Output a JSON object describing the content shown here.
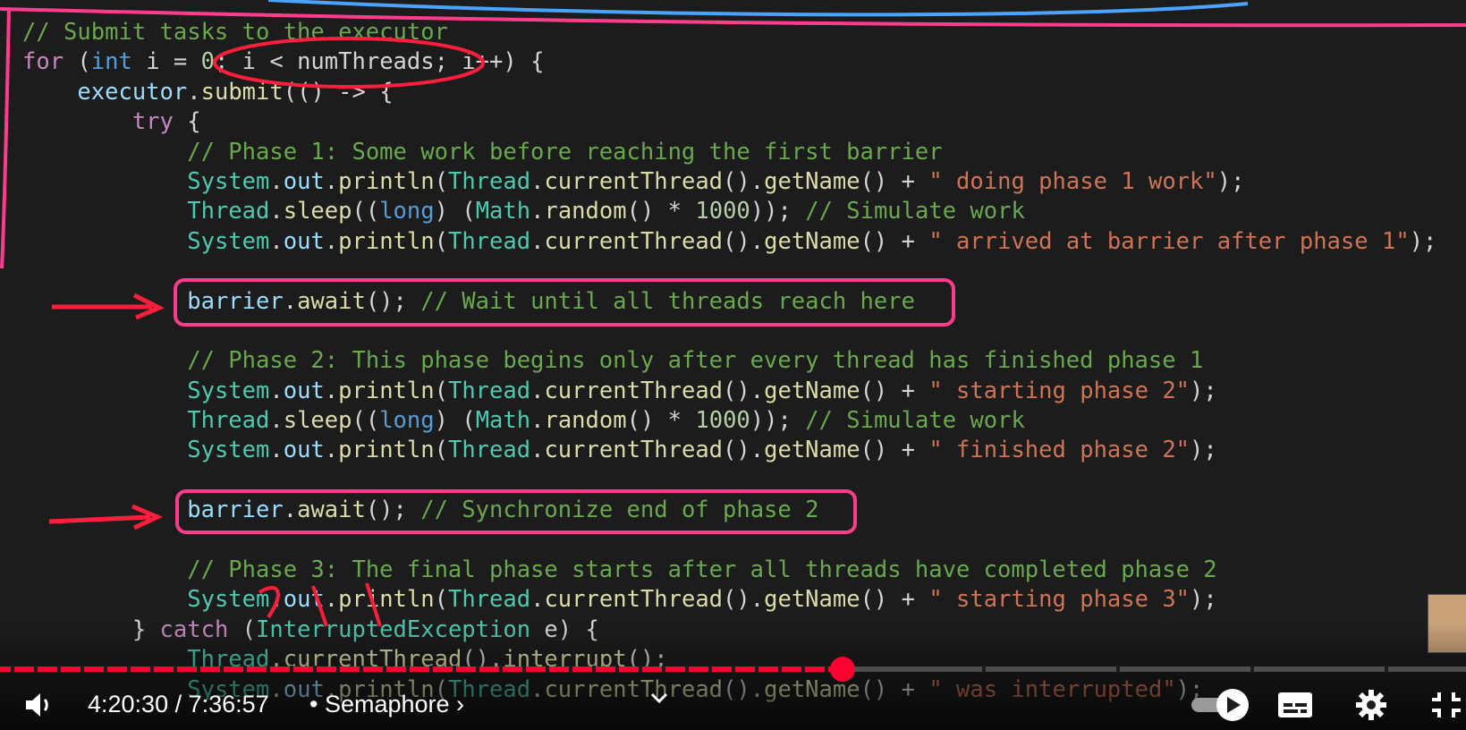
{
  "code_lines": [
    [
      [
        "c",
        "// Submit tasks to the executor"
      ]
    ],
    [
      [
        "kc",
        "for"
      ],
      [
        "p",
        " ("
      ],
      [
        "k",
        "int"
      ],
      [
        "p",
        " i = "
      ],
      [
        "n",
        "0"
      ],
      [
        "p",
        "; i < numThreads; i++) {"
      ]
    ],
    [
      [
        "p",
        "    "
      ],
      [
        "v",
        "executor"
      ],
      [
        "p",
        "."
      ],
      [
        "f",
        "submit"
      ],
      [
        "p",
        "(() -> {"
      ]
    ],
    [
      [
        "p",
        "        "
      ],
      [
        "kc",
        "try"
      ],
      [
        "p",
        " {"
      ]
    ],
    [
      [
        "p",
        "            "
      ],
      [
        "c",
        "// Phase 1: Some work before reaching the first barrier"
      ]
    ],
    [
      [
        "p",
        "            "
      ],
      [
        "t",
        "System"
      ],
      [
        "p",
        "."
      ],
      [
        "v",
        "out"
      ],
      [
        "p",
        "."
      ],
      [
        "f",
        "println"
      ],
      [
        "p",
        "("
      ],
      [
        "t",
        "Thread"
      ],
      [
        "p",
        "."
      ],
      [
        "f",
        "currentThread"
      ],
      [
        "p",
        "()."
      ],
      [
        "f",
        "getName"
      ],
      [
        "p",
        "() + "
      ],
      [
        "s",
        "\" doing phase 1 work\""
      ],
      [
        "p",
        ");"
      ]
    ],
    [
      [
        "p",
        "            "
      ],
      [
        "t",
        "Thread"
      ],
      [
        "p",
        "."
      ],
      [
        "f",
        "sleep"
      ],
      [
        "p",
        "(("
      ],
      [
        "k",
        "long"
      ],
      [
        "p",
        ") ("
      ],
      [
        "t",
        "Math"
      ],
      [
        "p",
        "."
      ],
      [
        "f",
        "random"
      ],
      [
        "p",
        "() * "
      ],
      [
        "n",
        "1000"
      ],
      [
        "p",
        "));"
      ],
      [
        "c",
        " // Simulate work"
      ]
    ],
    [
      [
        "p",
        "            "
      ],
      [
        "t",
        "System"
      ],
      [
        "p",
        "."
      ],
      [
        "v",
        "out"
      ],
      [
        "p",
        "."
      ],
      [
        "f",
        "println"
      ],
      [
        "p",
        "("
      ],
      [
        "t",
        "Thread"
      ],
      [
        "p",
        "."
      ],
      [
        "f",
        "currentThread"
      ],
      [
        "p",
        "()."
      ],
      [
        "f",
        "getName"
      ],
      [
        "p",
        "() + "
      ],
      [
        "s",
        "\" arrived at barrier after phase 1\""
      ],
      [
        "p",
        ");"
      ]
    ],
    [
      [
        "p",
        ""
      ]
    ],
    [
      [
        "p",
        "            "
      ],
      [
        "v",
        "barrier"
      ],
      [
        "p",
        "."
      ],
      [
        "f",
        "await"
      ],
      [
        "p",
        "(); "
      ],
      [
        "c",
        "// Wait until all threads reach here"
      ]
    ],
    [
      [
        "p",
        ""
      ]
    ],
    [
      [
        "p",
        "            "
      ],
      [
        "c",
        "// Phase 2: This phase begins only after every thread has finished phase 1"
      ]
    ],
    [
      [
        "p",
        "            "
      ],
      [
        "t",
        "System"
      ],
      [
        "p",
        "."
      ],
      [
        "v",
        "out"
      ],
      [
        "p",
        "."
      ],
      [
        "f",
        "println"
      ],
      [
        "p",
        "("
      ],
      [
        "t",
        "Thread"
      ],
      [
        "p",
        "."
      ],
      [
        "f",
        "currentThread"
      ],
      [
        "p",
        "()."
      ],
      [
        "f",
        "getName"
      ],
      [
        "p",
        "() + "
      ],
      [
        "s",
        "\" starting phase 2\""
      ],
      [
        "p",
        ");"
      ]
    ],
    [
      [
        "p",
        "            "
      ],
      [
        "t",
        "Thread"
      ],
      [
        "p",
        "."
      ],
      [
        "f",
        "sleep"
      ],
      [
        "p",
        "(("
      ],
      [
        "k",
        "long"
      ],
      [
        "p",
        ") ("
      ],
      [
        "t",
        "Math"
      ],
      [
        "p",
        "."
      ],
      [
        "f",
        "random"
      ],
      [
        "p",
        "() * "
      ],
      [
        "n",
        "1000"
      ],
      [
        "p",
        "));"
      ],
      [
        "c",
        " // Simulate work"
      ]
    ],
    [
      [
        "p",
        "            "
      ],
      [
        "t",
        "System"
      ],
      [
        "p",
        "."
      ],
      [
        "v",
        "out"
      ],
      [
        "p",
        "."
      ],
      [
        "f",
        "println"
      ],
      [
        "p",
        "("
      ],
      [
        "t",
        "Thread"
      ],
      [
        "p",
        "."
      ],
      [
        "f",
        "currentThread"
      ],
      [
        "p",
        "()."
      ],
      [
        "f",
        "getName"
      ],
      [
        "p",
        "() + "
      ],
      [
        "s",
        "\" finished phase 2\""
      ],
      [
        "p",
        ");"
      ]
    ],
    [
      [
        "p",
        ""
      ]
    ],
    [
      [
        "p",
        "            "
      ],
      [
        "v",
        "barrier"
      ],
      [
        "p",
        "."
      ],
      [
        "f",
        "await"
      ],
      [
        "p",
        "(); "
      ],
      [
        "c",
        "// Synchronize end of phase 2"
      ]
    ],
    [
      [
        "p",
        ""
      ]
    ],
    [
      [
        "p",
        "            "
      ],
      [
        "c",
        "// Phase 3: The final phase starts after all threads have completed phase 2"
      ]
    ],
    [
      [
        "p",
        "            "
      ],
      [
        "t",
        "System"
      ],
      [
        "p",
        "."
      ],
      [
        "v",
        "out"
      ],
      [
        "p",
        "."
      ],
      [
        "f",
        "println"
      ],
      [
        "p",
        "("
      ],
      [
        "t",
        "Thread"
      ],
      [
        "p",
        "."
      ],
      [
        "f",
        "currentThread"
      ],
      [
        "p",
        "()."
      ],
      [
        "f",
        "getName"
      ],
      [
        "p",
        "() + "
      ],
      [
        "s",
        "\" starting phase 3\""
      ],
      [
        "p",
        ");"
      ]
    ],
    [
      [
        "p",
        "        } "
      ],
      [
        "kc",
        "catch"
      ],
      [
        "p",
        " ("
      ],
      [
        "t",
        "InterruptedException"
      ],
      [
        "p",
        " e) {"
      ]
    ],
    [
      [
        "p",
        "            "
      ],
      [
        "t",
        "Thread"
      ],
      [
        "p",
        "."
      ],
      [
        "f",
        "currentThread"
      ],
      [
        "p",
        "()."
      ],
      [
        "f",
        "interrupt"
      ],
      [
        "p",
        "();"
      ]
    ],
    [
      [
        "p",
        "            "
      ],
      [
        "t",
        "System"
      ],
      [
        "p",
        "."
      ],
      [
        "v",
        "out"
      ],
      [
        "p",
        "."
      ],
      [
        "f",
        "println"
      ],
      [
        "p",
        "("
      ],
      [
        "t",
        "Thread"
      ],
      [
        "p",
        "."
      ],
      [
        "f",
        "currentThread"
      ],
      [
        "p",
        "()."
      ],
      [
        "f",
        "getName"
      ],
      [
        "p",
        "() + "
      ],
      [
        "s",
        "\" was interrupted\""
      ],
      [
        "p",
        ");"
      ]
    ]
  ],
  "player": {
    "time_current": "4:20:30",
    "time_separator": " / ",
    "time_total": "7:36:57",
    "chapter_title": "• Semaphore ›",
    "progress_fraction": 0.575,
    "accent_color": "#ff0033"
  },
  "icons": {
    "volume": "volume-icon",
    "chevron": "chevron-down-icon",
    "autoplay": "autoplay-toggle-icon",
    "subtitles": "subtitles-icon",
    "settings": "gear-icon",
    "exit_fullscreen": "exit-fullscreen-icon"
  }
}
